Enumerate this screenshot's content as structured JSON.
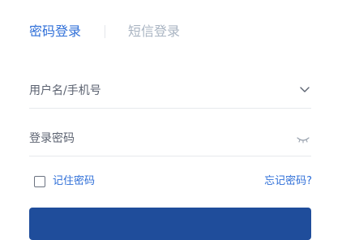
{
  "tabs": [
    {
      "label": "密码登录",
      "active": true
    },
    {
      "label": "短信登录",
      "active": false
    }
  ],
  "form": {
    "username": {
      "placeholder": "用户名/手机号",
      "value": "",
      "icon": "chevron-down-icon"
    },
    "password": {
      "placeholder": "登录密码",
      "value": "",
      "icon": "eye-closed-icon"
    }
  },
  "options": {
    "remember_label": "记住密码",
    "remember_checked": false,
    "forgot_label": "忘记密码?"
  },
  "colors": {
    "accent": "#2f6fd8",
    "inactive_tab": "#a9b4c2",
    "divider": "#e6e9ed",
    "button": "#1f4d9b"
  }
}
